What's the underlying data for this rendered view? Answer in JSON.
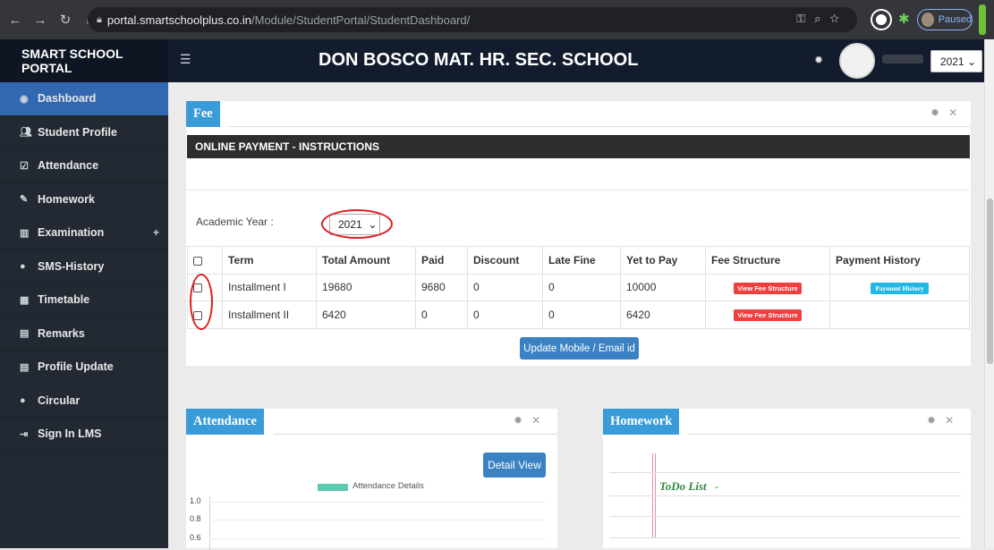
{
  "browser": {
    "url_host": "portal.smartschoolplus.co.in",
    "url_path": "/Module/StudentPortal/StudentDashboard/",
    "profile_status": "Paused",
    "nav_icons": [
      "back-arrow-icon",
      "forward-arrow-icon",
      "reload-icon",
      "home-icon"
    ]
  },
  "header": {
    "brand": "SMART SCHOOL PORTAL",
    "school_name": "DON BOSCO MAT. HR. SEC. SCHOOL",
    "year_select": "2021"
  },
  "sidebar": {
    "items": [
      {
        "label": "Dashboard",
        "icon": "dashboard-icon",
        "active": true
      },
      {
        "label": "Student Profile",
        "icon": "users-icon"
      },
      {
        "label": "Attendance",
        "icon": "check-square-icon"
      },
      {
        "label": "Homework",
        "icon": "edit-icon"
      },
      {
        "label": "Examination",
        "icon": "bar-chart-icon",
        "expand": "+"
      },
      {
        "label": "SMS-History",
        "icon": "comments-icon"
      },
      {
        "label": "Timetable",
        "icon": "calendar-icon"
      },
      {
        "label": "Remarks",
        "icon": "list-alt-icon"
      },
      {
        "label": "Profile Update",
        "icon": "list-alt-icon"
      },
      {
        "label": "Circular",
        "icon": "comment-icon"
      },
      {
        "label": "Sign In LMS",
        "icon": "sign-in-icon"
      }
    ]
  },
  "fee": {
    "title": "Fee",
    "bar_title": "ONLINE PAYMENT - INSTRUCTIONS",
    "academic_year_label": "Academic Year :",
    "academic_year_value": "2021",
    "columns": [
      "Term",
      "Total Amount",
      "Paid",
      "Discount",
      "Late Fine",
      "Yet to Pay",
      "Fee Structure",
      "Payment History"
    ],
    "rows": [
      {
        "term": "Installment I",
        "total": "19680",
        "paid": "9680",
        "discount": "0",
        "late_fine": "0",
        "yet_to_pay": "10000",
        "structure_btn": "View Fee Structure",
        "history_btn": "Payment History"
      },
      {
        "term": "Installment II",
        "total": "6420",
        "paid": "0",
        "discount": "0",
        "late_fine": "0",
        "yet_to_pay": "6420",
        "structure_btn": "View Fee Structure",
        "history_btn": ""
      }
    ],
    "update_button": "Update Mobile / Email id"
  },
  "attendance": {
    "title": "Attendance",
    "detail_button": "Detail View",
    "legend": "Attendance Details",
    "legend_color": "#5cc9b0",
    "y_ticks": [
      "1.0",
      "0.8",
      "0.6"
    ]
  },
  "homework": {
    "title": "Homework",
    "todo_label": "ToDo List",
    "todo_suffix": "-"
  },
  "colors": {
    "panel_header": "#3a9bd9",
    "sidebar_active": "#3268b0",
    "danger_button": "#ee3f3f",
    "info_button": "#22b8e6",
    "primary_button": "#3a82c4",
    "annotation_red": "#e01b1b"
  }
}
